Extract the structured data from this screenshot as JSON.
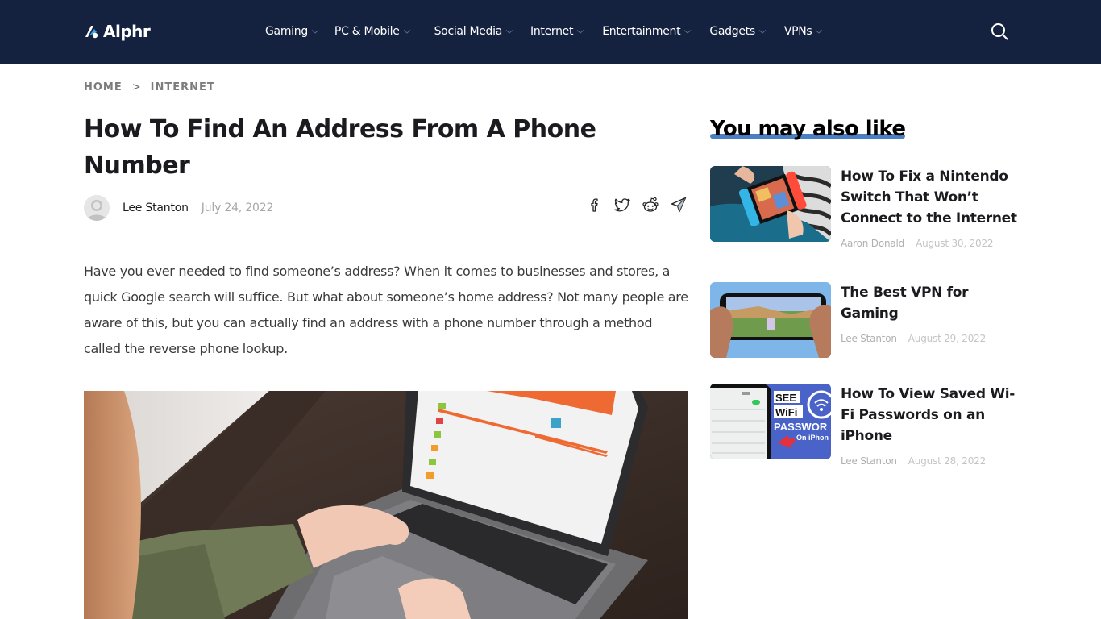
{
  "header": {
    "logo_text": "Alphr",
    "nav": [
      {
        "label": "Gaming"
      },
      {
        "label": "PC & Mobile"
      },
      {
        "label": "Social Media"
      },
      {
        "label": "Internet"
      },
      {
        "label": "Entertainment"
      },
      {
        "label": "Gadgets"
      },
      {
        "label": "VPNs"
      }
    ],
    "search_icon": "search-icon"
  },
  "breadcrumb": {
    "items": [
      "HOME",
      "INTERNET"
    ],
    "separator": ">"
  },
  "article": {
    "title": "How To Find An Address From A Phone Number",
    "author": "Lee Stanton",
    "date": "July 24, 2022",
    "share_icons": [
      "facebook-icon",
      "twitter-icon",
      "reddit-icon",
      "send-icon"
    ],
    "intro": "Have you ever needed to find someone’s address? When it comes to businesses and stores, a quick Google search will suffice. But what about someone’s home address? Not many people are aware of this, but you can actually find an address with a phone number through a method called the reverse phone lookup.",
    "hero_image": "person typing on laptop showing reverse phone lookup results"
  },
  "sidebar": {
    "heading": "You may also like",
    "accent_color": "#4a7fc1",
    "cards": [
      {
        "title": "How To Fix a Nintendo Switch That Won’t Connect to the Internet",
        "author": "Aaron Donald",
        "date": "August 30, 2022",
        "thumb": "nintendo switch in hands"
      },
      {
        "title": "The Best VPN for Gaming",
        "author": "Lee Stanton",
        "date": "August 29, 2022",
        "thumb": "phone gaming in landscape"
      },
      {
        "title": "How To View Saved Wi-Fi Passwords on an iPhone",
        "author": "Lee Stanton",
        "date": "August 28, 2022",
        "thumb": "see wifi password on iphone"
      }
    ],
    "thumb_texts": {
      "see": "SEE",
      "wifi": "WiFi",
      "password": "PASSWOR",
      "on_iphone": "On iPhon"
    }
  },
  "colors": {
    "header_bg": "#15223f",
    "text_dark": "#1b1b1f",
    "muted": "#a7a7a7"
  }
}
